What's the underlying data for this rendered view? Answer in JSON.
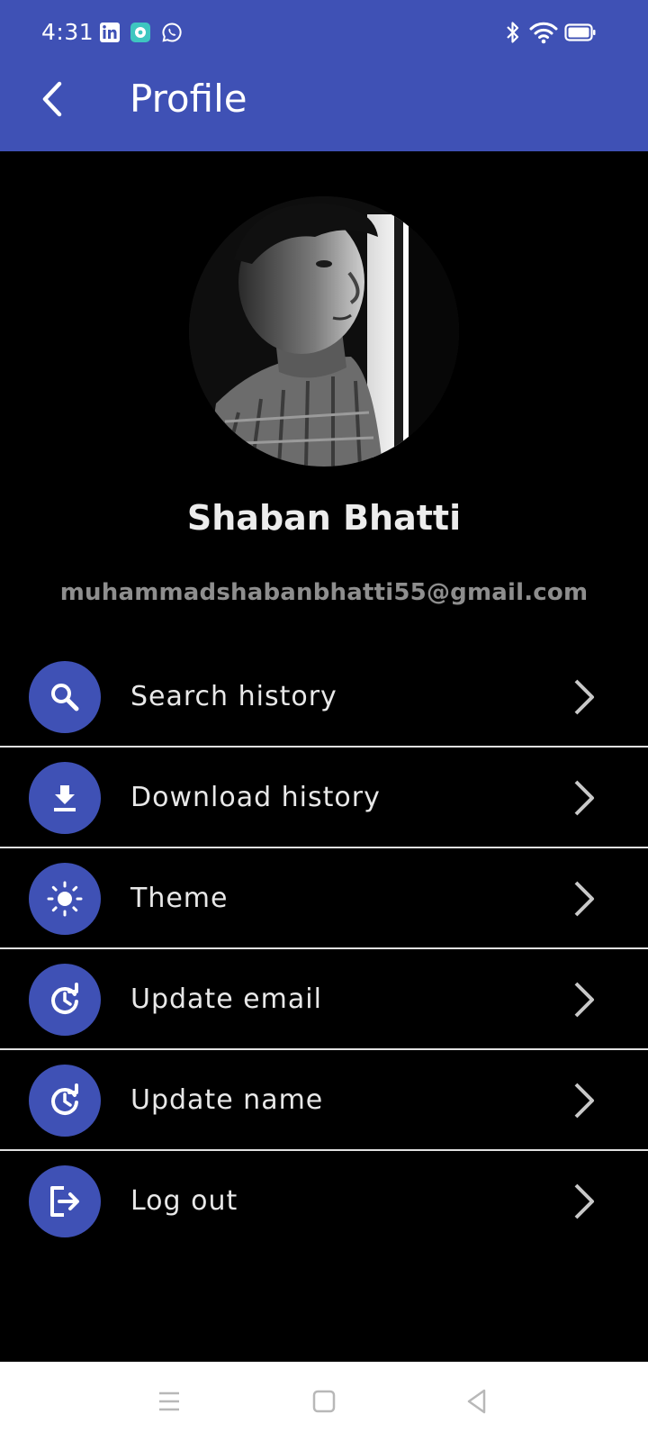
{
  "status_bar": {
    "time": "4:31",
    "notification_icons": [
      "linkedin-icon",
      "app-notification-icon",
      "whatsapp-icon"
    ],
    "system_icons": [
      "bluetooth-icon",
      "wifi-icon",
      "battery-icon"
    ]
  },
  "app_bar": {
    "title": "Profile",
    "back_icon": "arrow-back-icon"
  },
  "profile": {
    "name": "Shaban Bhatti",
    "email": "muhammadshabanbhatti55@gmail.com",
    "avatar": "profile-photo"
  },
  "menu": {
    "items": [
      {
        "label": "Search history",
        "icon": "search-icon"
      },
      {
        "label": "Download history",
        "icon": "download-icon"
      },
      {
        "label": "Theme",
        "icon": "brightness-icon"
      },
      {
        "label": "Update email",
        "icon": "update-icon"
      },
      {
        "label": "Update name",
        "icon": "update-icon"
      },
      {
        "label": "Log out",
        "icon": "logout-icon"
      }
    ]
  },
  "nav_bar": {
    "buttons": [
      "menu-icon",
      "home-icon",
      "back-icon"
    ]
  },
  "colors": {
    "primary": "#3f51b5",
    "background": "#000000",
    "text": "#e8e8e8",
    "email_text": "#8e8e8e",
    "divider": "#e0e0e0",
    "nav_bar": "#ffffff"
  }
}
